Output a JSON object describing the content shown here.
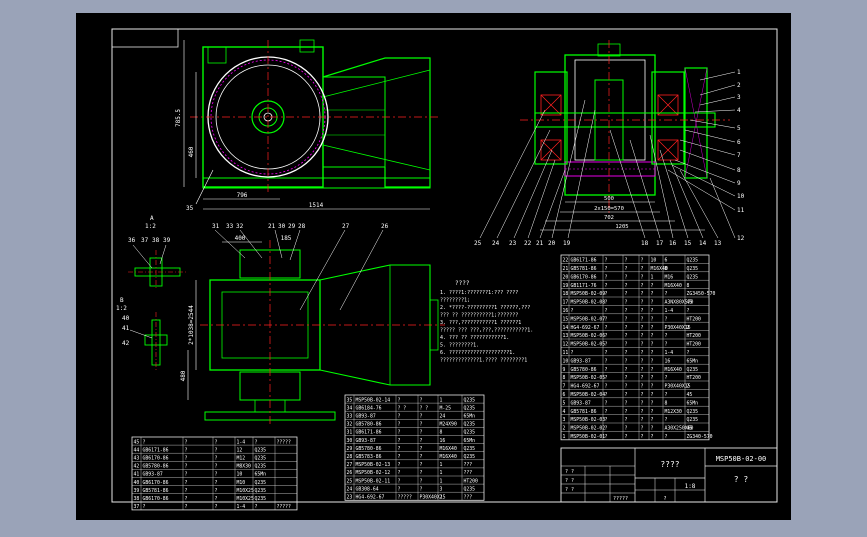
{
  "colors": {
    "background": "#9aa3b8",
    "sheet": "#000000",
    "frame": "#e8e8e8",
    "table_lines": "#e8e8e8",
    "part_outline": "#00ff00",
    "center_line": "#ff2020",
    "dimension": "#ffffff",
    "leader": "#ffffff",
    "hatch": "#ff00ff",
    "note_text": "#ffffff"
  },
  "dimensions": {
    "front_height_1": "785.5",
    "front_height_2": "460",
    "front_width_1": "796",
    "front_width_2": "1514",
    "top_height_1": "2*1038=2544",
    "top_height_2": "400",
    "top_height_3": "480",
    "top_width_1": "400",
    "top_width_2": "185",
    "side_width_1": "2x150=570",
    "side_width_2": "702",
    "side_width_3": "1205",
    "side_width_4": "500"
  },
  "callouts": {
    "front_bottom": "35",
    "top_view": [
      "31",
      "33",
      "32",
      "21",
      "30",
      "29",
      "28",
      "27",
      "26"
    ],
    "detail_a": [
      "36",
      "37",
      "38",
      "39"
    ],
    "detail_b": [
      "40",
      "41",
      "42"
    ],
    "side_right": [
      "1",
      "2",
      "3",
      "4",
      "5",
      "6",
      "7",
      "8",
      "9",
      "10",
      "11",
      "12"
    ],
    "side_bottom": [
      "25",
      "24",
      "23",
      "22",
      "21",
      "20",
      "19",
      "18",
      "17",
      "16",
      "15",
      "14",
      "13"
    ]
  },
  "detail_labels": {
    "detail_a_title": "A",
    "detail_a_scale": "1:2",
    "detail_b_title": "B",
    "detail_b_scale": "1:2"
  },
  "notes": {
    "title": "????",
    "lines": [
      "1. ????1:???????1:???     ????",
      "   ????????1;",
      "2. *????-?????????1        ??????,???",
      "   ???  ??  ??????????1;???????",
      "3. ???,???????????1         ??????1",
      "   ?????  ??? ???,???,???????????1.",
      "4. ??? ??  ???????????1.",
      "5. ????????1.",
      "6. ????????????????????1.",
      "   ?????????????1.????           ????????1"
    ]
  },
  "parts_list_upper": {
    "rows": [
      [
        "22",
        "GB6171-86",
        "?",
        "?",
        "?",
        "10",
        "6",
        "Q235"
      ],
      [
        "21",
        "GB5781-86",
        "?",
        "?",
        "?",
        "M16X40",
        "8",
        "Q235"
      ],
      [
        "20",
        "GB6170-86",
        "?",
        "?",
        "?",
        "1",
        "M16",
        "Q235"
      ],
      [
        "19",
        "GB1171-76",
        "?",
        "?",
        "?",
        "?",
        "M16X40",
        "8"
      ],
      [
        "18",
        "MSP50B-02-09",
        "?",
        "?",
        "?",
        "?",
        "?",
        "ZG3450-570"
      ],
      [
        "17",
        "MSP50B-02-08",
        "?",
        "?",
        "?",
        "?",
        "A3NX80X570",
        "45"
      ],
      [
        "16",
        "?",
        "?",
        "?",
        "?",
        "?",
        "1-4",
        "?",
        "1"
      ],
      [
        "15",
        "MSP50B-02-07",
        "?",
        "?",
        "?",
        "?",
        "?",
        "HT200"
      ],
      [
        "14",
        "HG4-692-67",
        "?",
        "?",
        "?",
        "?",
        "P30X40X16",
        "2"
      ],
      [
        "13",
        "MSP50B-02-06",
        "?",
        "?",
        "?",
        "?",
        "?",
        "HT200"
      ],
      [
        "12",
        "MSP50B-02-05",
        "?",
        "?",
        "?",
        "?",
        "?",
        "HT200"
      ],
      [
        "11",
        "?",
        "?",
        "?",
        "?",
        "?",
        "1-4",
        "?",
        "?"
      ],
      [
        "10",
        "GB93-87",
        "?",
        "?",
        "?",
        "?",
        "16",
        "65Mn"
      ],
      [
        "9",
        "GB5780-86",
        "?",
        "?",
        "?",
        "?",
        "M16X40",
        "Q235"
      ],
      [
        "8",
        "MSP50B-02-05",
        "?",
        "?",
        "?",
        "?",
        "?",
        "HT200"
      ],
      [
        "7",
        "HG4-692-67",
        "?",
        "?",
        "?",
        "?",
        "P30X40X15",
        "2"
      ],
      [
        "6",
        "MSP50B-02-04",
        "?",
        "?",
        "?",
        "?",
        "?",
        "45"
      ],
      [
        "5",
        "GB93-87",
        "?",
        "?",
        "?",
        "?",
        "8",
        "65Mn"
      ],
      [
        "4",
        "GB5781-86",
        "?",
        "?",
        "?",
        "?",
        "M12X30",
        "Q235"
      ],
      [
        "3",
        "MSP50B-02-03",
        "?",
        "?",
        "?",
        "?",
        "?",
        "Q235"
      ],
      [
        "2",
        "MSP50B-02-02",
        "?",
        "?",
        "?",
        "?",
        "A30X250X60",
        "45"
      ],
      [
        "1",
        "MSP50B-02-01",
        "?",
        "?",
        "?",
        "?",
        "?",
        "ZG340-570"
      ]
    ],
    "header": [
      "??",
      "??",
      "??",
      "??",
      "??",
      "??",
      "?",
      "?"
    ]
  },
  "parts_list_middle": {
    "rows": [
      [
        "35",
        "MSP50B-02-14",
        "?",
        "?",
        "1",
        "Q235"
      ],
      [
        "34",
        "GB6184-76",
        "? ?",
        "? ?",
        "M-25",
        "Q235"
      ],
      [
        "33",
        "GB93-87",
        "?",
        "?",
        "24",
        "65Mn"
      ],
      [
        "32",
        "GB5780-86",
        "?",
        "?",
        "M24X90",
        "Q235"
      ],
      [
        "31",
        "GB6171-86",
        "?",
        "?",
        "8",
        "Q235"
      ],
      [
        "30",
        "GB93-87",
        "?",
        "?",
        "16",
        "65Mn"
      ],
      [
        "29",
        "GB5780-86",
        "?",
        "?",
        "M16X40",
        "Q235"
      ],
      [
        "28",
        "GB5783-86",
        "?",
        "?",
        "M16X40",
        "Q235"
      ],
      [
        "27",
        "MSP50B-02-13",
        "?",
        "?",
        "1",
        "???"
      ],
      [
        "26",
        "MSP50B-02-12",
        "?",
        "?",
        "1",
        "???"
      ],
      [
        "25",
        "MSP50B-02-11",
        "?",
        "?",
        "1",
        "HT200"
      ],
      [
        "24",
        "GB308-64",
        "?",
        "?",
        "3",
        "Q235"
      ],
      [
        "23",
        "HG4-692-67",
        "?????",
        "P30X40X15",
        "2",
        "???"
      ]
    ]
  },
  "parts_list_lower": {
    "rows": [
      [
        "45",
        "?",
        "?",
        "?",
        "1-4",
        "?",
        "?????"
      ],
      [
        "44",
        "GB6171-86",
        "?",
        "?",
        "12",
        "Q235"
      ],
      [
        "43",
        "GB6170-86",
        "?",
        "?",
        "M12",
        "Q235"
      ],
      [
        "42",
        "GB5780-86",
        "?",
        "?",
        "M8X30",
        "Q235"
      ],
      [
        "41",
        "GB93-87",
        "?",
        "?",
        "10",
        "65Mn"
      ],
      [
        "40",
        "GB6170-86",
        "?",
        "?",
        "M10",
        "Q235"
      ],
      [
        "39",
        "GB5781-86",
        "?",
        "?",
        "M10X25",
        "Q235"
      ],
      [
        "38",
        "GB6170-86",
        "?",
        "?",
        "M10X25",
        "Q235"
      ],
      [
        "37",
        "?",
        "?",
        "?",
        "1-4",
        "?",
        "?????"
      ]
    ]
  },
  "title_block": {
    "drawing_name": "????",
    "drawing_number": "MSP50B-02-00",
    "company": "? ?",
    "scale": "1:8",
    "sheet_info": "?",
    "designer_label": "? ?",
    "checker_label": "? ?",
    "approver_label": "? ?",
    "date_label": "?????"
  }
}
